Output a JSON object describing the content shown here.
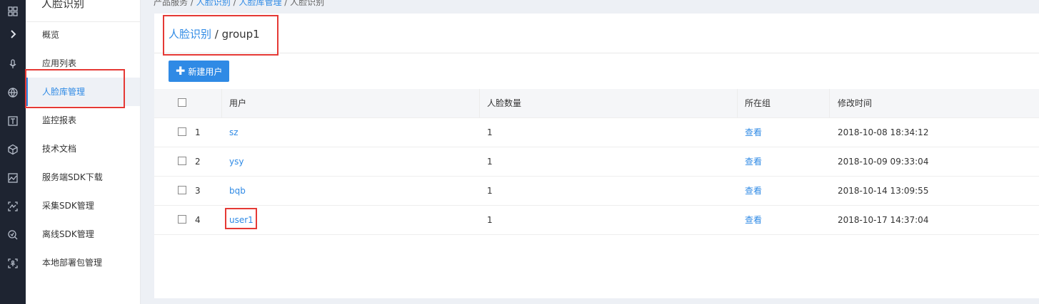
{
  "app": {
    "title": "人脸识别"
  },
  "breadcrumb": {
    "root": "产品服务",
    "sep1": "/",
    "crumb1": "人脸识别",
    "sep2": "/",
    "crumb2": "人脸库管理",
    "sep3": "/",
    "current": "人脸识别"
  },
  "sidebar": {
    "items": [
      {
        "label": "概览"
      },
      {
        "label": "应用列表"
      },
      {
        "label": "人脸库管理"
      },
      {
        "label": "监控报表"
      },
      {
        "label": "技术文档"
      },
      {
        "label": "服务端SDK下载"
      },
      {
        "label": "采集SDK管理"
      },
      {
        "label": "离线SDK管理"
      },
      {
        "label": "本地部署包管理"
      }
    ]
  },
  "rail_icons": [
    "grid-icon",
    "chevron-right-icon",
    "microphone-icon",
    "globe-icon",
    "text-icon",
    "cube-icon",
    "chart-icon",
    "face-scan-icon",
    "face-search-icon",
    "body-scan-icon"
  ],
  "page": {
    "title_link": "人脸识别",
    "title_sep": " / ",
    "title_group": "group1"
  },
  "toolbar": {
    "new_user_label": "新建用户"
  },
  "table": {
    "headers": {
      "user": "用户",
      "face_count": "人脸数量",
      "group": "所在组",
      "modified": "修改时间"
    },
    "rows": [
      {
        "index": "1",
        "user": "sz",
        "face_count": "1",
        "group": "查看",
        "modified": "2018-10-08 18:34:12"
      },
      {
        "index": "2",
        "user": "ysy",
        "face_count": "1",
        "group": "查看",
        "modified": "2018-10-09 09:33:04"
      },
      {
        "index": "3",
        "user": "bqb",
        "face_count": "1",
        "group": "查看",
        "modified": "2018-10-14 13:09:55"
      },
      {
        "index": "4",
        "user": "user1",
        "face_count": "1",
        "group": "查看",
        "modified": "2018-10-17 14:37:04"
      }
    ]
  },
  "colors": {
    "accent": "#2f8ae5",
    "highlight": "#e53935",
    "rail": "#1e2431"
  }
}
